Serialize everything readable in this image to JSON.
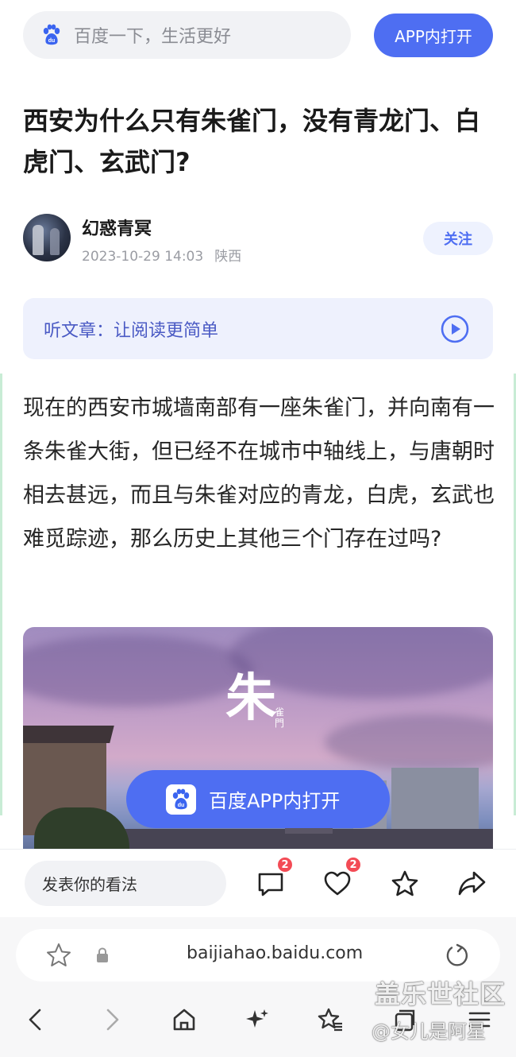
{
  "search": {
    "placeholder": "百度一下，生活更好",
    "open_app": "APP内打开"
  },
  "article": {
    "title": "西安为什么只有朱雀门，没有青龙门、白虎门、玄武门?",
    "author": "幻惑青冥",
    "date": "2023-10-29 14:03",
    "location": "陕西",
    "follow": "关注",
    "listen": "听文章：让阅读更简单",
    "body": "现在的西安市城墙南部有一座朱雀门，并向南有一条朱雀大街，但已经不在城市中轴线上，与唐朝时相去甚远，而且与朱雀对应的青龙，白虎，玄武也难觅踪迹，那么历史上其他三个门存在过吗?"
  },
  "image": {
    "emblem_big": "朱",
    "emblem_small": "雀門",
    "open_app_button": "百度APP内打开"
  },
  "comment_bar": {
    "placeholder": "发表你的看法",
    "comment_count": "2",
    "like_count": "2"
  },
  "browser": {
    "url": "baijiahao.baidu.com"
  },
  "watermark": {
    "line1": "盖乐世社区",
    "line2": "@女儿是阿星"
  },
  "colors": {
    "accent": "#4e6ef2",
    "badge": "#f34b55"
  }
}
